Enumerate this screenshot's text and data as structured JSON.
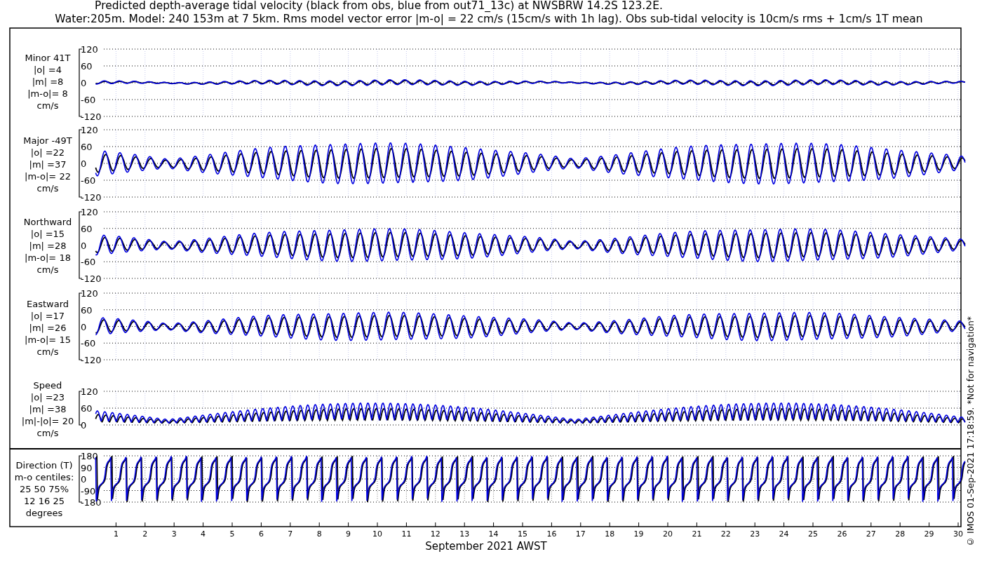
{
  "title_lines": [
    "Predicted depth-average tidal velocity (black from obs, blue from out71_13c) at NWSBRW 14.2S 123.2E.",
    "Water:205m. Model: 240 153m at 7 5km. Rms model vector error |m-o| = 22 cm/s (15cm/s with 1h lag). Obs sub-tidal velocity is 10cm/s rms + 1cm/s 1T mean"
  ],
  "panels": [
    {
      "kind": "velocity",
      "label_lines": [
        "Minor 41T",
        "|o| =4",
        "|m| =8",
        "|m-o|= 8",
        "cm/s"
      ],
      "yticks": [
        "120",
        "60",
        "0",
        "-60",
        "-120"
      ]
    },
    {
      "kind": "velocity",
      "label_lines": [
        "Major -49T",
        "|o| =22",
        "|m| =37",
        "|m-o|= 22",
        "cm/s"
      ],
      "yticks": [
        "120",
        "60",
        "0",
        "-60",
        "-120"
      ]
    },
    {
      "kind": "velocity",
      "label_lines": [
        "Northward",
        "|o| =15",
        "|m| =28",
        "|m-o|= 18",
        "cm/s"
      ],
      "yticks": [
        "120",
        "60",
        "0",
        "-60",
        "-120"
      ]
    },
    {
      "kind": "velocity",
      "label_lines": [
        "Eastward",
        "|o| =17",
        "|m| =26",
        "|m-o|= 15",
        "cm/s"
      ],
      "yticks": [
        "120",
        "60",
        "0",
        "-60",
        "-120"
      ]
    },
    {
      "kind": "speed",
      "label_lines": [
        "Speed",
        "|o| =23",
        "|m| =38",
        "|m|-|o|= 20",
        "cm/s"
      ],
      "yticks": [
        "120",
        "60",
        "0"
      ]
    },
    {
      "kind": "direction",
      "label_lines": [
        "Direction (T)",
        "m-o centiles:",
        "25  50  75%",
        "12  16  25",
        "degrees"
      ],
      "yticks": [
        "180",
        "90",
        "0",
        "-90",
        "-180"
      ]
    }
  ],
  "xaxis": {
    "ticks": [
      "1",
      "2",
      "3",
      "4",
      "5",
      "6",
      "7",
      "8",
      "9",
      "10",
      "11",
      "12",
      "13",
      "14",
      "15",
      "16",
      "17",
      "18",
      "19",
      "20",
      "21",
      "22",
      "23",
      "24",
      "25",
      "26",
      "27",
      "28",
      "29",
      "30"
    ],
    "label": "September 2021 AWST"
  },
  "credit": "© IMOS 01-Sep-2021 17:18:59. *Not for navigation*"
}
